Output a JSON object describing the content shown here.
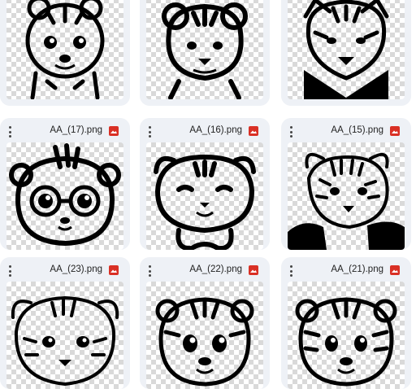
{
  "files": [
    {
      "name": ""
    },
    {
      "name": ""
    },
    {
      "name": ""
    },
    {
      "name": "AA_(17).png"
    },
    {
      "name": "AA_(16).png"
    },
    {
      "name": "AA_(15).png"
    },
    {
      "name": "AA_(23).png"
    },
    {
      "name": "AA_(22).png"
    },
    {
      "name": "AA_(21).png"
    }
  ],
  "file_type_icon": "image-file-icon",
  "menu_icon": "more-vertical-icon",
  "colors": {
    "card_bg": "#eef1f6",
    "file_icon": "#d93025",
    "checker": "#d9d9d9"
  }
}
